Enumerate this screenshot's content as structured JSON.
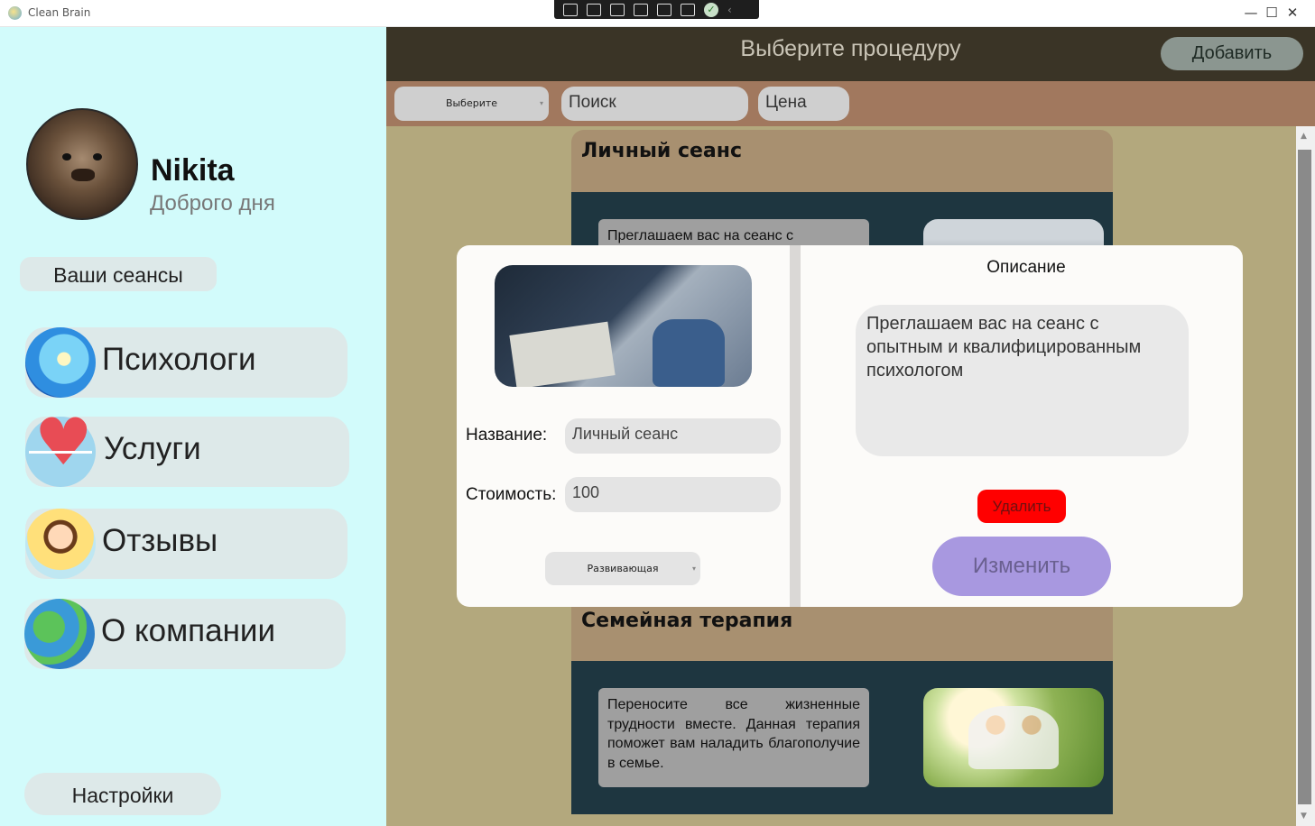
{
  "window": {
    "title": "Clean Brain",
    "minimize": "—",
    "maximize": "☐",
    "close": "✕"
  },
  "sidebar": {
    "user_name": "Nikita",
    "greeting": "Доброго дня",
    "sessions_label": "Ваши сеансы",
    "nav": [
      {
        "label": "Психологи",
        "icon": "brain-icon"
      },
      {
        "label": "Услуги",
        "icon": "heart-pulse-icon"
      },
      {
        "label": "Отзывы",
        "icon": "happy-person-icon"
      },
      {
        "label": "О компании",
        "icon": "globe-icon"
      }
    ],
    "settings_label": "Настройки"
  },
  "header": {
    "title": "Выберите процедуру",
    "add_label": "Добавить"
  },
  "filters": {
    "category_value": "Выберите",
    "search_placeholder": "Поиск",
    "price_placeholder": "Цена"
  },
  "cards": [
    {
      "title": "Личный сеанс",
      "description": "Преглашаем вас на сеанс с"
    },
    {
      "title": "Семейная терапия",
      "description": "Переносите все жизненные трудности вместе. Данная терапия поможет вам наладить благополучие в семье."
    }
  ],
  "modal": {
    "name_label": "Название:",
    "name_value": "Личный сеанс",
    "cost_label": "Стоимость:",
    "cost_value": "100",
    "type_value": "Развивающая",
    "description_title": "Описание",
    "description_value": "Преглашаем вас на сеанс с опытным и квалифицированным психологом",
    "delete_label": "Удалить",
    "edit_label": "Изменить"
  },
  "colors": {
    "sidebar_bg": "#d2fbfb",
    "header_bg": "#3a3426",
    "filterbar_bg": "#a1785e",
    "content_bg": "#b3a87d",
    "card_head_bg": "#a89070",
    "card_body_bg": "#1e3640",
    "delete_red": "#ff0000",
    "edit_purple": "#a898e0"
  }
}
